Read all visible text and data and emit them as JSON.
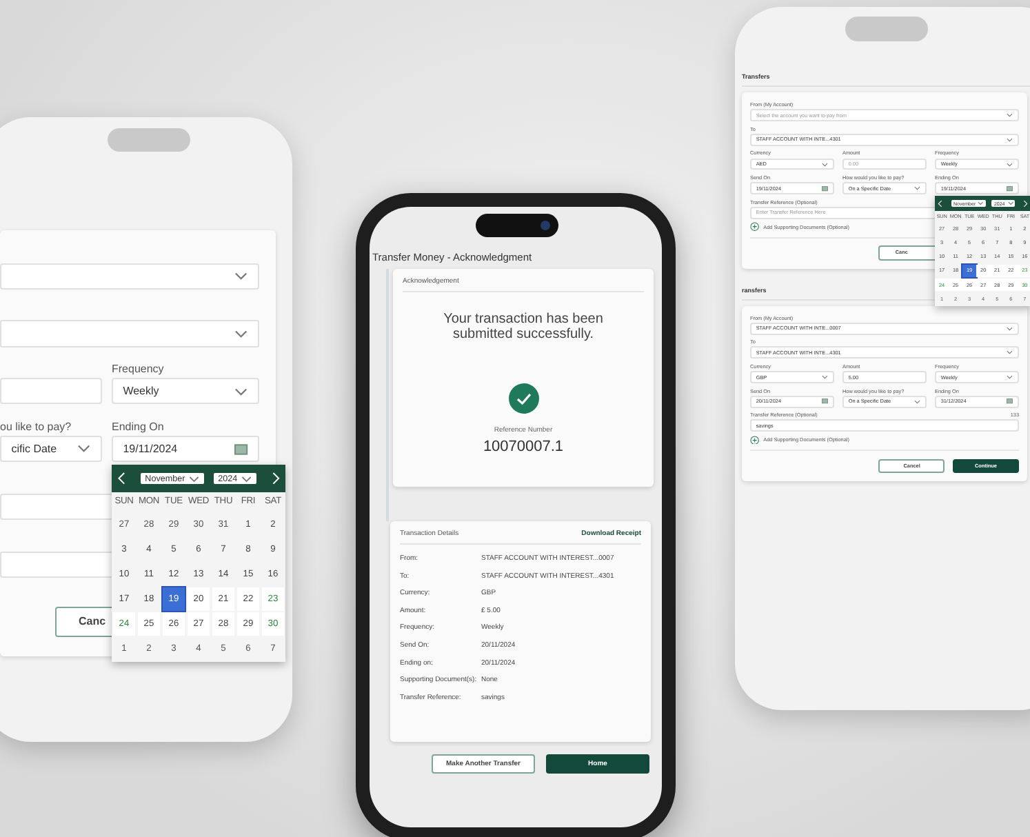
{
  "left_phone": {
    "form": {
      "rows": [
        [
          {
            "kind": "select"
          }
        ],
        [
          {
            "kind": "select"
          }
        ],
        [
          {
            "kind": "input"
          },
          {
            "label": "Frequency",
            "kind": "select",
            "value": "Weekly"
          }
        ],
        [
          {
            "label": "ou like to pay?",
            "kind": "select",
            "value": "cific Date"
          },
          {
            "label": "Ending On",
            "kind": "date",
            "value": "19/11/2024",
            "calendar": {
              "month": "November",
              "year": "2024",
              "weekdays": [
                "SUN",
                "MON",
                "TUE",
                "WED",
                "THU",
                "FRI",
                "SAT"
              ],
              "weeks": [
                [
                  {
                    "day": "27",
                    "kind": "outside",
                    "selected": false
                  },
                  {
                    "day": "28",
                    "kind": "outside",
                    "selected": false
                  },
                  {
                    "day": "29",
                    "kind": "outside",
                    "selected": false
                  },
                  {
                    "day": "30",
                    "kind": "outside",
                    "selected": false
                  },
                  {
                    "day": "31",
                    "kind": "outside",
                    "selected": false
                  },
                  {
                    "day": "1",
                    "kind": "past",
                    "selected": false
                  },
                  {
                    "day": "2",
                    "kind": "past",
                    "selected": false
                  }
                ],
                [
                  {
                    "day": "3",
                    "kind": "past",
                    "selected": false
                  },
                  {
                    "day": "4",
                    "kind": "past",
                    "selected": false
                  },
                  {
                    "day": "5",
                    "kind": "past",
                    "selected": false
                  },
                  {
                    "day": "6",
                    "kind": "past",
                    "selected": false
                  },
                  {
                    "day": "7",
                    "kind": "past",
                    "selected": false
                  },
                  {
                    "day": "8",
                    "kind": "past",
                    "selected": false
                  },
                  {
                    "day": "9",
                    "kind": "past",
                    "selected": false
                  }
                ],
                [
                  {
                    "day": "10",
                    "kind": "past",
                    "selected": false
                  },
                  {
                    "day": "11",
                    "kind": "past",
                    "selected": false
                  },
                  {
                    "day": "12",
                    "kind": "past",
                    "selected": false
                  },
                  {
                    "day": "13",
                    "kind": "past",
                    "selected": false
                  },
                  {
                    "day": "14",
                    "kind": "past",
                    "selected": false
                  },
                  {
                    "day": "15",
                    "kind": "past",
                    "selected": false
                  },
                  {
                    "day": "16",
                    "kind": "past",
                    "selected": false
                  }
                ],
                [
                  {
                    "day": "17",
                    "kind": "past",
                    "selected": false
                  },
                  {
                    "day": "18",
                    "kind": "past",
                    "selected": false
                  },
                  {
                    "day": "19",
                    "kind": "open",
                    "selected": true
                  },
                  {
                    "day": "20",
                    "kind": "open",
                    "selected": false
                  },
                  {
                    "day": "21",
                    "kind": "open",
                    "selected": false
                  },
                  {
                    "day": "22",
                    "kind": "open",
                    "selected": false
                  },
                  {
                    "day": "23",
                    "kind": "weekend",
                    "selected": false
                  }
                ],
                [
                  {
                    "day": "24",
                    "kind": "weekend",
                    "selected": false
                  },
                  {
                    "day": "25",
                    "kind": "open",
                    "selected": false
                  },
                  {
                    "day": "26",
                    "kind": "open",
                    "selected": false
                  },
                  {
                    "day": "27",
                    "kind": "open",
                    "selected": false
                  },
                  {
                    "day": "28",
                    "kind": "open",
                    "selected": false
                  },
                  {
                    "day": "29",
                    "kind": "open",
                    "selected": false
                  },
                  {
                    "day": "30",
                    "kind": "weekend",
                    "selected": false
                  }
                ],
                [
                  {
                    "day": "1",
                    "kind": "outside",
                    "selected": false
                  },
                  {
                    "day": "2",
                    "kind": "outside",
                    "selected": false
                  },
                  {
                    "day": "3",
                    "kind": "outside",
                    "selected": false
                  },
                  {
                    "day": "4",
                    "kind": "outside",
                    "selected": false
                  },
                  {
                    "day": "5",
                    "kind": "outside",
                    "selected": false
                  },
                  {
                    "day": "6",
                    "kind": "outside",
                    "selected": false
                  },
                  {
                    "day": "7",
                    "kind": "outside",
                    "selected": false
                  }
                ]
              ]
            }
          }
        ],
        [
          {
            "kind": "input"
          }
        ],
        [
          {
            "kind": "input"
          }
        ]
      ],
      "buttons": [
        {
          "label": "Canc",
          "kind": "secondary"
        }
      ]
    }
  },
  "center_phone": {
    "title": "Transfer Money - Acknowledgment",
    "acknowledgement": {
      "header": "Acknowledgement",
      "message": "Your transaction has been submitted successfully.",
      "reference_label": "Reference Number",
      "reference_number": "10070007.1"
    },
    "details": {
      "header": "Transaction Details",
      "link": "Download Receipt",
      "rows": [
        {
          "label": "From:",
          "value": "STAFF ACCOUNT WITH INTEREST...0007"
        },
        {
          "label": "To:",
          "value": "STAFF ACCOUNT WITH INTEREST...4301"
        },
        {
          "label": "Currency:",
          "value": "GBP"
        },
        {
          "label": "Amount:",
          "value": "£ 5.00"
        },
        {
          "label": "Frequency:",
          "value": "Weekly"
        },
        {
          "label": "Send On:",
          "value": "20/11/2024"
        },
        {
          "label": "Ending on:",
          "value": "20/11/2024"
        },
        {
          "label": "Supporting Document(s):",
          "value": "None"
        },
        {
          "label": "Transfer Reference:",
          "value": "savings"
        }
      ]
    },
    "buttons": [
      {
        "label": "Make Another Transfer",
        "kind": "secondary"
      },
      {
        "label": "Home",
        "kind": "primary"
      }
    ]
  },
  "right_phone": {
    "screens": [
      {
        "title": "Transfers",
        "form": {
          "rows": [
            [
              {
                "label": "From (My Account)",
                "kind": "select",
                "placeholder": "Select the account you want to pay from"
              }
            ],
            [
              {
                "label": "To",
                "kind": "select",
                "value": "STAFF ACCOUNT WITH INTE...4301"
              }
            ],
            [
              {
                "label": "Currency",
                "kind": "select",
                "value": "AED"
              },
              {
                "label": "Amount",
                "kind": "input",
                "placeholder": "0.00"
              },
              {
                "label": "Frequency",
                "kind": "select",
                "value": "Weekly"
              }
            ],
            [
              {
                "label": "Send On",
                "kind": "date",
                "value": "19/11/2024"
              },
              {
                "label": "How would you like to pay?",
                "kind": "select",
                "value": "On a Specific Date"
              },
              {
                "label": "Ending On",
                "kind": "date",
                "value": "19/11/2024",
                "calendar": {
                  "month": "November",
                  "year": "2024",
                  "weekdays": [
                    "SUN",
                    "MON",
                    "TUE",
                    "WED",
                    "THU",
                    "FRI",
                    "SAT"
                  ],
                  "weeks": [
                    [
                      {
                        "day": "27",
                        "kind": "outside",
                        "selected": false
                      },
                      {
                        "day": "28",
                        "kind": "outside",
                        "selected": false
                      },
                      {
                        "day": "29",
                        "kind": "outside",
                        "selected": false
                      },
                      {
                        "day": "30",
                        "kind": "outside",
                        "selected": false
                      },
                      {
                        "day": "31",
                        "kind": "outside",
                        "selected": false
                      },
                      {
                        "day": "1",
                        "kind": "past",
                        "selected": false
                      },
                      {
                        "day": "2",
                        "kind": "past",
                        "selected": false
                      }
                    ],
                    [
                      {
                        "day": "3",
                        "kind": "past",
                        "selected": false
                      },
                      {
                        "day": "4",
                        "kind": "past",
                        "selected": false
                      },
                      {
                        "day": "5",
                        "kind": "past",
                        "selected": false
                      },
                      {
                        "day": "6",
                        "kind": "past",
                        "selected": false
                      },
                      {
                        "day": "7",
                        "kind": "past",
                        "selected": false
                      },
                      {
                        "day": "8",
                        "kind": "past",
                        "selected": false
                      },
                      {
                        "day": "9",
                        "kind": "past",
                        "selected": false
                      }
                    ],
                    [
                      {
                        "day": "10",
                        "kind": "past",
                        "selected": false
                      },
                      {
                        "day": "11",
                        "kind": "past",
                        "selected": false
                      },
                      {
                        "day": "12",
                        "kind": "past",
                        "selected": false
                      },
                      {
                        "day": "13",
                        "kind": "past",
                        "selected": false
                      },
                      {
                        "day": "14",
                        "kind": "past",
                        "selected": false
                      },
                      {
                        "day": "15",
                        "kind": "past",
                        "selected": false
                      },
                      {
                        "day": "16",
                        "kind": "past",
                        "selected": false
                      }
                    ],
                    [
                      {
                        "day": "17",
                        "kind": "past",
                        "selected": false
                      },
                      {
                        "day": "18",
                        "kind": "past",
                        "selected": false
                      },
                      {
                        "day": "19",
                        "kind": "open",
                        "selected": true
                      },
                      {
                        "day": "20",
                        "kind": "open",
                        "selected": false
                      },
                      {
                        "day": "21",
                        "kind": "open",
                        "selected": false
                      },
                      {
                        "day": "22",
                        "kind": "open",
                        "selected": false
                      },
                      {
                        "day": "23",
                        "kind": "weekend",
                        "selected": false
                      }
                    ],
                    [
                      {
                        "day": "24",
                        "kind": "weekend",
                        "selected": false
                      },
                      {
                        "day": "25",
                        "kind": "open",
                        "selected": false
                      },
                      {
                        "day": "26",
                        "kind": "open",
                        "selected": false
                      },
                      {
                        "day": "27",
                        "kind": "open",
                        "selected": false
                      },
                      {
                        "day": "28",
                        "kind": "open",
                        "selected": false
                      },
                      {
                        "day": "29",
                        "kind": "open",
                        "selected": false
                      },
                      {
                        "day": "30",
                        "kind": "weekend",
                        "selected": false
                      }
                    ],
                    [
                      {
                        "day": "1",
                        "kind": "outside",
                        "selected": false
                      },
                      {
                        "day": "2",
                        "kind": "outside",
                        "selected": false
                      },
                      {
                        "day": "3",
                        "kind": "outside",
                        "selected": false
                      },
                      {
                        "day": "4",
                        "kind": "outside",
                        "selected": false
                      },
                      {
                        "day": "5",
                        "kind": "outside",
                        "selected": false
                      },
                      {
                        "day": "6",
                        "kind": "outside",
                        "selected": false
                      },
                      {
                        "day": "7",
                        "kind": "outside",
                        "selected": false
                      }
                    ]
                  ]
                }
              }
            ],
            [
              {
                "label": "Transfer Reference (Optional)",
                "kind": "input",
                "placeholder": "Enter Transfer Reference Here"
              }
            ]
          ],
          "add_documents": "Add Supporting Documents (Optional)",
          "buttons": [
            {
              "label": "Canc",
              "kind": "secondary"
            }
          ]
        }
      },
      {
        "title": "ransfers",
        "form": {
          "rows": [
            [
              {
                "label": "From (My Account)",
                "kind": "select",
                "value": "STAFF ACCOUNT WITH INTE...0007"
              }
            ],
            [
              {
                "label": "To",
                "kind": "select",
                "value": "STAFF ACCOUNT WITH INTE...4301"
              }
            ],
            [
              {
                "label": "Currency",
                "kind": "select",
                "value": "GBP"
              },
              {
                "label": "Amount",
                "kind": "input",
                "value": "5.00"
              },
              {
                "label": "Frequency",
                "kind": "select",
                "value": "Weekly"
              }
            ],
            [
              {
                "label": "Send On",
                "kind": "date",
                "value": "20/11/2024"
              },
              {
                "label": "How would you like to pay?",
                "kind": "select",
                "value": "On a Specific Date"
              },
              {
                "label": "Ending On",
                "kind": "date",
                "value": "31/12/2024"
              }
            ],
            [
              {
                "label": "Transfer Reference (Optional)",
                "counter": "133",
                "kind": "input",
                "value": "savings"
              }
            ]
          ],
          "add_documents": "Add Supporting Documents (Optional)",
          "buttons": [
            {
              "label": "Cancel",
              "kind": "secondary"
            },
            {
              "label": "Continue",
              "kind": "primary"
            }
          ]
        }
      }
    ]
  }
}
